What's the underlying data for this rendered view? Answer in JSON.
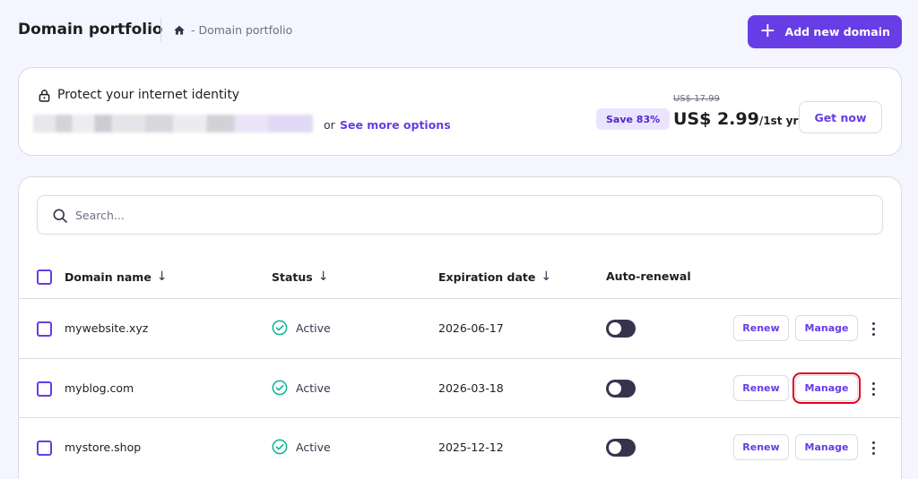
{
  "header": {
    "title": "Domain portfolio",
    "breadcrumb": "- Domain portfolio",
    "add_button_label": "Add new domain"
  },
  "promo": {
    "title": "Protect your internet identity",
    "or_text": "or",
    "link_label": "See more options",
    "save_badge": "Save 83%",
    "old_price": "US$ 17.99",
    "price": "US$ 2.99",
    "price_period": "/1st yr",
    "cta_label": "Get now"
  },
  "search": {
    "placeholder": "Search..."
  },
  "table": {
    "columns": {
      "domain": "Domain name",
      "status": "Status",
      "expiration": "Expiration date",
      "auto_renewal": "Auto-renewal"
    },
    "rows": [
      {
        "domain": "mywebsite.xyz",
        "status": "Active",
        "expiration": "2026-06-17",
        "auto_renewal": false,
        "renew": "Renew",
        "manage": "Manage"
      },
      {
        "domain": "myblog.com",
        "status": "Active",
        "expiration": "2026-03-18",
        "auto_renewal": false,
        "renew": "Renew",
        "manage": "Manage"
      },
      {
        "domain": "mystore.shop",
        "status": "Active",
        "expiration": "2025-12-12",
        "auto_renewal": false,
        "renew": "Renew",
        "manage": "Manage"
      }
    ]
  },
  "colors": {
    "accent": "#673de6",
    "active_green": "#00b090",
    "highlight": "#e3001b"
  },
  "icons": [
    "home-icon",
    "plus-icon",
    "lock-icon",
    "search-icon",
    "check-circle-icon",
    "sort-arrow-icon",
    "kebab-menu-icon"
  ]
}
